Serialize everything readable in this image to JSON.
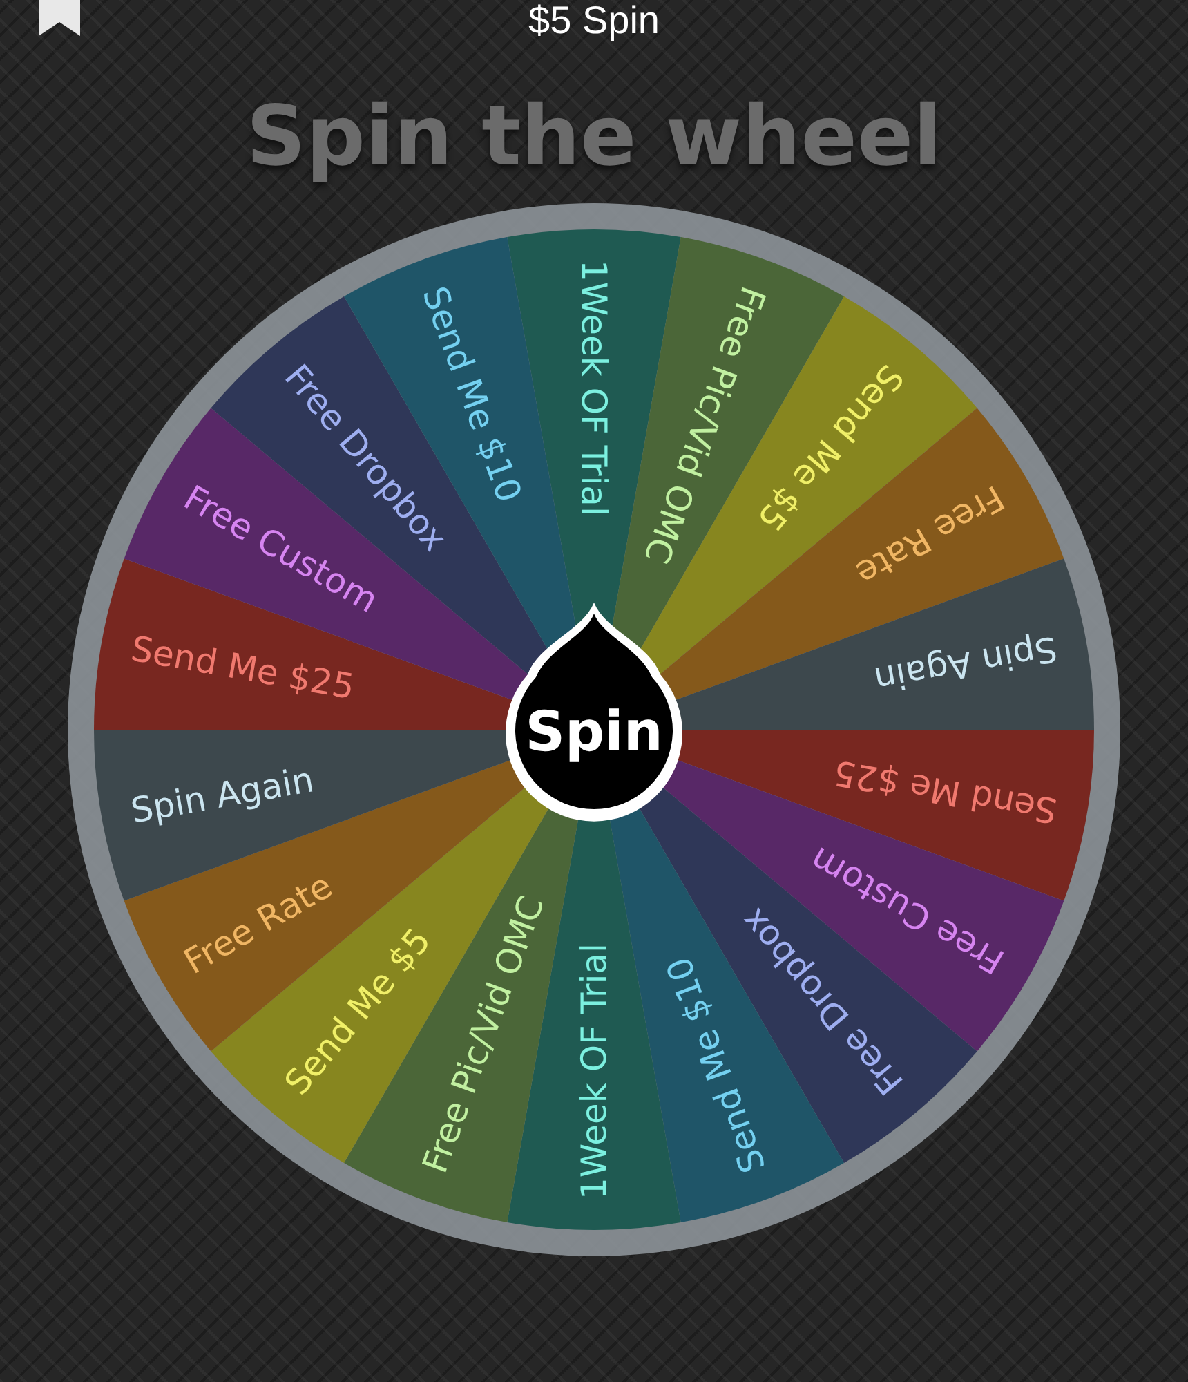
{
  "header": {
    "title": "$5 Spin"
  },
  "heading": "Spin the wheel",
  "wheel": {
    "button": "Spin",
    "segments": [
      {
        "label": "1Week OF Trial",
        "color": "#1f5a52"
      },
      {
        "label": "Free Pic/Vid OMC",
        "color": "#4b6638"
      },
      {
        "label": "Send Me $5",
        "color": "#87861f"
      },
      {
        "label": "Free Rate",
        "color": "#85591b"
      },
      {
        "label": "Spin Again",
        "color": "#3d484d"
      },
      {
        "label": "Send Me $25",
        "color": "#782720"
      },
      {
        "label": "Free Custom",
        "color": "#582867"
      },
      {
        "label": "Free Dropbox",
        "color": "#2f3758"
      },
      {
        "label": "Send Me $10",
        "color": "#1f5568"
      },
      {
        "label": "1Week OF Trial",
        "color": "#1f5a52"
      },
      {
        "label": "Free Pic/Vid OMC",
        "color": "#4b6638"
      },
      {
        "label": "Send Me $5",
        "color": "#87861f"
      },
      {
        "label": "Free Rate",
        "color": "#85591b"
      },
      {
        "label": "Spin Again",
        "color": "#3d484d"
      },
      {
        "label": "Send Me $25",
        "color": "#782720"
      },
      {
        "label": "Free Custom",
        "color": "#582867"
      },
      {
        "label": "Free Dropbox",
        "color": "#2f3758"
      },
      {
        "label": "Send Me $10",
        "color": "#1f5568"
      }
    ]
  }
}
